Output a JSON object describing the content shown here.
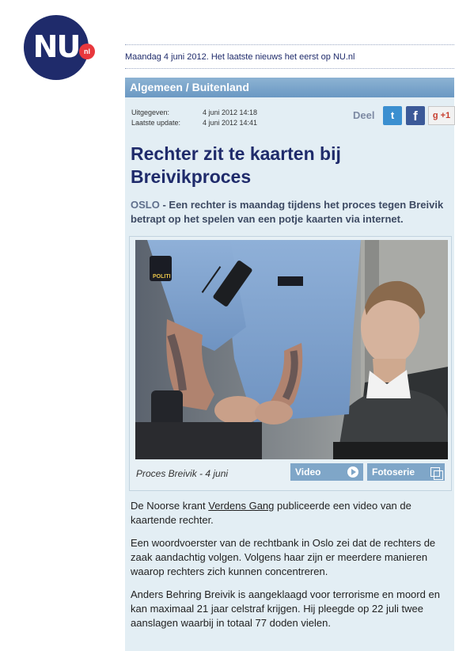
{
  "logo": {
    "text": "NU",
    "badge": "nl"
  },
  "tagline": "Maandag 4 juni 2012. Het laatste nieuws het eerst op NU.nl",
  "section": "Algemeen / Buitenland",
  "meta": {
    "published_label": "Uitgegeven:",
    "published_value": "4 juni 2012 14:18",
    "updated_label": "Laatste update:",
    "updated_value": "4 juni 2012 14:41"
  },
  "share": {
    "label": "Deel",
    "twitter": "t",
    "facebook": "f",
    "gplus": "g +1"
  },
  "headline": "Rechter zit te kaarten bij Breivikproces",
  "lead": {
    "city": "OSLO",
    "text": " - Een rechter is maandag tijdens het proces tegen Breivik betrapt op het spelen van een potje kaarten via internet."
  },
  "photo": {
    "caption": "Proces Breivik - 4 juni",
    "video_button": "Video",
    "fotoserie_button": "Fotoserie",
    "patch_text": "POLITI"
  },
  "body": {
    "p1_before": "De Noorse krant ",
    "p1_link": "Verdens Gang",
    "p1_after": " publiceerde een video van de kaartende rechter.",
    "p2": "Een woordvoerster van de rechtbank in Oslo zei dat de rechters de zaak aandachtig volgen. Volgens haar zijn er meerdere manieren waarop rechters zich kunnen concentreren.",
    "p3": "Anders Behring Breivik is aangeklaagd voor terrorisme en moord en kan maximaal 21 jaar celstraf krijgen. Hij pleegde op 22 juli twee aanslagen waarbij in totaal 77 doden vielen."
  },
  "colors": {
    "brand": "#1f2b6b",
    "accent": "#e8383d",
    "column_bg": "#e3eef4",
    "section_bar": "#7fa6c8"
  }
}
